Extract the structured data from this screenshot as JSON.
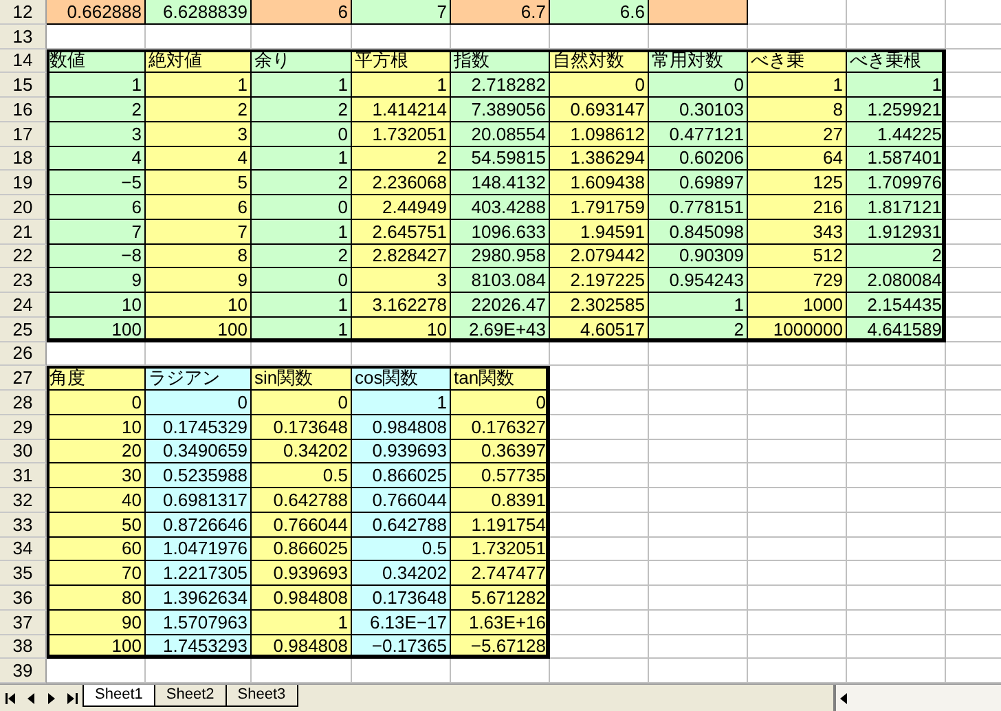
{
  "sheet": {
    "sections": [
      {
        "kind": "plain",
        "rows": [
          {
            "number": "12",
            "kind": "data",
            "cells": [
              {
                "text": "0.662888",
                "color": "#ffcc99"
              },
              {
                "text": "6.6288839",
                "color": "#ccffcc"
              },
              {
                "text": "6",
                "color": "#ffcc99"
              },
              {
                "text": "7",
                "color": "#ccffcc"
              },
              {
                "text": "6.7",
                "color": "#ffcc99"
              },
              {
                "text": "6.6",
                "color": "#ccffcc"
              },
              {
                "text": "",
                "color": "#ffcc99"
              }
            ]
          },
          {
            "number": "13",
            "cells": []
          }
        ]
      },
      {
        "kind": "table",
        "rows": [
          {
            "number": "14",
            "kind": "header",
            "cells": [
              {
                "text": "数値",
                "color": "#ccffcc"
              },
              {
                "text": "絶対値",
                "color": "#ffff99"
              },
              {
                "text": "余り",
                "color": "#ccffcc"
              },
              {
                "text": "平方根",
                "color": "#ffff99"
              },
              {
                "text": "指数",
                "color": "#ccffcc"
              },
              {
                "text": "自然対数",
                "color": "#ffff99"
              },
              {
                "text": "常用対数",
                "color": "#ccffcc"
              },
              {
                "text": "べき乗",
                "color": "#ffff99"
              },
              {
                "text": "べき乗根",
                "color": "#ccffcc"
              }
            ]
          },
          {
            "number": "15",
            "kind": "data",
            "cells": [
              {
                "text": "1",
                "color": "#ccffcc"
              },
              {
                "text": "1",
                "color": "#ffff99"
              },
              {
                "text": "1",
                "color": "#ccffcc"
              },
              {
                "text": "1",
                "color": "#ffff99"
              },
              {
                "text": "2.718282",
                "color": "#ccffcc"
              },
              {
                "text": "0",
                "color": "#ffff99"
              },
              {
                "text": "0",
                "color": "#ccffcc"
              },
              {
                "text": "1",
                "color": "#ffff99"
              },
              {
                "text": "1",
                "color": "#ccffcc"
              }
            ]
          },
          {
            "number": "16",
            "kind": "data",
            "cells": [
              {
                "text": "2",
                "color": "#ccffcc"
              },
              {
                "text": "2",
                "color": "#ffff99"
              },
              {
                "text": "2",
                "color": "#ccffcc"
              },
              {
                "text": "1.414214",
                "color": "#ffff99"
              },
              {
                "text": "7.389056",
                "color": "#ccffcc"
              },
              {
                "text": "0.693147",
                "color": "#ffff99"
              },
              {
                "text": "0.30103",
                "color": "#ccffcc"
              },
              {
                "text": "8",
                "color": "#ffff99"
              },
              {
                "text": "1.259921",
                "color": "#ccffcc"
              }
            ]
          },
          {
            "number": "17",
            "kind": "data",
            "cells": [
              {
                "text": "3",
                "color": "#ccffcc"
              },
              {
                "text": "3",
                "color": "#ffff99"
              },
              {
                "text": "0",
                "color": "#ccffcc"
              },
              {
                "text": "1.732051",
                "color": "#ffff99"
              },
              {
                "text": "20.08554",
                "color": "#ccffcc"
              },
              {
                "text": "1.098612",
                "color": "#ffff99"
              },
              {
                "text": "0.477121",
                "color": "#ccffcc"
              },
              {
                "text": "27",
                "color": "#ffff99"
              },
              {
                "text": "1.44225",
                "color": "#ccffcc"
              }
            ]
          },
          {
            "number": "18",
            "kind": "data",
            "cells": [
              {
                "text": "4",
                "color": "#ccffcc"
              },
              {
                "text": "4",
                "color": "#ffff99"
              },
              {
                "text": "1",
                "color": "#ccffcc"
              },
              {
                "text": "2",
                "color": "#ffff99"
              },
              {
                "text": "54.59815",
                "color": "#ccffcc"
              },
              {
                "text": "1.386294",
                "color": "#ffff99"
              },
              {
                "text": "0.60206",
                "color": "#ccffcc"
              },
              {
                "text": "64",
                "color": "#ffff99"
              },
              {
                "text": "1.587401",
                "color": "#ccffcc"
              }
            ]
          },
          {
            "number": "19",
            "kind": "data",
            "cells": [
              {
                "text": "−5",
                "color": "#ccffcc"
              },
              {
                "text": "5",
                "color": "#ffff99"
              },
              {
                "text": "2",
                "color": "#ccffcc"
              },
              {
                "text": "2.236068",
                "color": "#ffff99"
              },
              {
                "text": "148.4132",
                "color": "#ccffcc"
              },
              {
                "text": "1.609438",
                "color": "#ffff99"
              },
              {
                "text": "0.69897",
                "color": "#ccffcc"
              },
              {
                "text": "125",
                "color": "#ffff99"
              },
              {
                "text": "1.709976",
                "color": "#ccffcc"
              }
            ]
          },
          {
            "number": "20",
            "kind": "data",
            "cells": [
              {
                "text": "6",
                "color": "#ccffcc"
              },
              {
                "text": "6",
                "color": "#ffff99"
              },
              {
                "text": "0",
                "color": "#ccffcc"
              },
              {
                "text": "2.44949",
                "color": "#ffff99"
              },
              {
                "text": "403.4288",
                "color": "#ccffcc"
              },
              {
                "text": "1.791759",
                "color": "#ffff99"
              },
              {
                "text": "0.778151",
                "color": "#ccffcc"
              },
              {
                "text": "216",
                "color": "#ffff99"
              },
              {
                "text": "1.817121",
                "color": "#ccffcc"
              }
            ]
          },
          {
            "number": "21",
            "kind": "data",
            "cells": [
              {
                "text": "7",
                "color": "#ccffcc"
              },
              {
                "text": "7",
                "color": "#ffff99"
              },
              {
                "text": "1",
                "color": "#ccffcc"
              },
              {
                "text": "2.645751",
                "color": "#ffff99"
              },
              {
                "text": "1096.633",
                "color": "#ccffcc"
              },
              {
                "text": "1.94591",
                "color": "#ffff99"
              },
              {
                "text": "0.845098",
                "color": "#ccffcc"
              },
              {
                "text": "343",
                "color": "#ffff99"
              },
              {
                "text": "1.912931",
                "color": "#ccffcc"
              }
            ]
          },
          {
            "number": "22",
            "kind": "data",
            "cells": [
              {
                "text": "−8",
                "color": "#ccffcc"
              },
              {
                "text": "8",
                "color": "#ffff99"
              },
              {
                "text": "2",
                "color": "#ccffcc"
              },
              {
                "text": "2.828427",
                "color": "#ffff99"
              },
              {
                "text": "2980.958",
                "color": "#ccffcc"
              },
              {
                "text": "2.079442",
                "color": "#ffff99"
              },
              {
                "text": "0.90309",
                "color": "#ccffcc"
              },
              {
                "text": "512",
                "color": "#ffff99"
              },
              {
                "text": "2",
                "color": "#ccffcc"
              }
            ]
          },
          {
            "number": "23",
            "kind": "data",
            "cells": [
              {
                "text": "9",
                "color": "#ccffcc"
              },
              {
                "text": "9",
                "color": "#ffff99"
              },
              {
                "text": "0",
                "color": "#ccffcc"
              },
              {
                "text": "3",
                "color": "#ffff99"
              },
              {
                "text": "8103.084",
                "color": "#ccffcc"
              },
              {
                "text": "2.197225",
                "color": "#ffff99"
              },
              {
                "text": "0.954243",
                "color": "#ccffcc"
              },
              {
                "text": "729",
                "color": "#ffff99"
              },
              {
                "text": "2.080084",
                "color": "#ccffcc"
              }
            ]
          },
          {
            "number": "24",
            "kind": "data",
            "cells": [
              {
                "text": "10",
                "color": "#ccffcc"
              },
              {
                "text": "10",
                "color": "#ffff99"
              },
              {
                "text": "1",
                "color": "#ccffcc"
              },
              {
                "text": "3.162278",
                "color": "#ffff99"
              },
              {
                "text": "22026.47",
                "color": "#ccffcc"
              },
              {
                "text": "2.302585",
                "color": "#ffff99"
              },
              {
                "text": "1",
                "color": "#ccffcc"
              },
              {
                "text": "1000",
                "color": "#ffff99"
              },
              {
                "text": "2.154435",
                "color": "#ccffcc"
              }
            ]
          },
          {
            "number": "25",
            "kind": "data",
            "cells": [
              {
                "text": "100",
                "color": "#ccffcc"
              },
              {
                "text": "100",
                "color": "#ffff99"
              },
              {
                "text": "1",
                "color": "#ccffcc"
              },
              {
                "text": "10",
                "color": "#ffff99"
              },
              {
                "text": "2.69E+43",
                "color": "#ccffcc"
              },
              {
                "text": "4.60517",
                "color": "#ffff99"
              },
              {
                "text": "2",
                "color": "#ccffcc"
              },
              {
                "text": "1000000",
                "color": "#ffff99"
              },
              {
                "text": "4.641589",
                "color": "#ccffcc"
              }
            ]
          }
        ]
      },
      {
        "rows": [
          {
            "number": "26",
            "cells": []
          }
        ]
      },
      {
        "kind": "table",
        "rows": [
          {
            "number": "27",
            "kind": "header",
            "cells": [
              {
                "text": "角度",
                "color": "#ffff99"
              },
              {
                "text": "ラジアン",
                "color": "#ccffff"
              },
              {
                "text": "sin関数",
                "color": "#ffff99"
              },
              {
                "text": "cos関数",
                "color": "#ccffff"
              },
              {
                "text": "tan関数",
                "color": "#ffff99"
              }
            ]
          },
          {
            "number": "28",
            "kind": "data",
            "cells": [
              {
                "text": "0",
                "color": "#ffff99"
              },
              {
                "text": "0",
                "color": "#ccffff"
              },
              {
                "text": "0",
                "color": "#ffff99"
              },
              {
                "text": "1",
                "color": "#ccffff"
              },
              {
                "text": "0",
                "color": "#ffff99"
              }
            ]
          },
          {
            "number": "29",
            "kind": "data",
            "cells": [
              {
                "text": "10",
                "color": "#ffff99"
              },
              {
                "text": "0.1745329",
                "color": "#ccffff"
              },
              {
                "text": "0.173648",
                "color": "#ffff99"
              },
              {
                "text": "0.984808",
                "color": "#ccffff"
              },
              {
                "text": "0.176327",
                "color": "#ffff99"
              }
            ]
          },
          {
            "number": "30",
            "kind": "data",
            "cells": [
              {
                "text": "20",
                "color": "#ffff99"
              },
              {
                "text": "0.3490659",
                "color": "#ccffff"
              },
              {
                "text": "0.34202",
                "color": "#ffff99"
              },
              {
                "text": "0.939693",
                "color": "#ccffff"
              },
              {
                "text": "0.36397",
                "color": "#ffff99"
              }
            ]
          },
          {
            "number": "31",
            "kind": "data",
            "cells": [
              {
                "text": "30",
                "color": "#ffff99"
              },
              {
                "text": "0.5235988",
                "color": "#ccffff"
              },
              {
                "text": "0.5",
                "color": "#ffff99"
              },
              {
                "text": "0.866025",
                "color": "#ccffff"
              },
              {
                "text": "0.57735",
                "color": "#ffff99"
              }
            ]
          },
          {
            "number": "32",
            "kind": "data",
            "cells": [
              {
                "text": "40",
                "color": "#ffff99"
              },
              {
                "text": "0.6981317",
                "color": "#ccffff"
              },
              {
                "text": "0.642788",
                "color": "#ffff99"
              },
              {
                "text": "0.766044",
                "color": "#ccffff"
              },
              {
                "text": "0.8391",
                "color": "#ffff99"
              }
            ]
          },
          {
            "number": "33",
            "kind": "data",
            "cells": [
              {
                "text": "50",
                "color": "#ffff99"
              },
              {
                "text": "0.8726646",
                "color": "#ccffff"
              },
              {
                "text": "0.766044",
                "color": "#ffff99"
              },
              {
                "text": "0.642788",
                "color": "#ccffff"
              },
              {
                "text": "1.191754",
                "color": "#ffff99"
              }
            ]
          },
          {
            "number": "34",
            "kind": "data",
            "cells": [
              {
                "text": "60",
                "color": "#ffff99"
              },
              {
                "text": "1.0471976",
                "color": "#ccffff"
              },
              {
                "text": "0.866025",
                "color": "#ffff99"
              },
              {
                "text": "0.5",
                "color": "#ccffff"
              },
              {
                "text": "1.732051",
                "color": "#ffff99"
              }
            ]
          },
          {
            "number": "35",
            "kind": "data",
            "cells": [
              {
                "text": "70",
                "color": "#ffff99"
              },
              {
                "text": "1.2217305",
                "color": "#ccffff"
              },
              {
                "text": "0.939693",
                "color": "#ffff99"
              },
              {
                "text": "0.34202",
                "color": "#ccffff"
              },
              {
                "text": "2.747477",
                "color": "#ffff99"
              }
            ]
          },
          {
            "number": "36",
            "kind": "data",
            "cells": [
              {
                "text": "80",
                "color": "#ffff99"
              },
              {
                "text": "1.3962634",
                "color": "#ccffff"
              },
              {
                "text": "0.984808",
                "color": "#ffff99"
              },
              {
                "text": "0.173648",
                "color": "#ccffff"
              },
              {
                "text": "5.671282",
                "color": "#ffff99"
              }
            ]
          },
          {
            "number": "37",
            "kind": "data",
            "cells": [
              {
                "text": "90",
                "color": "#ffff99"
              },
              {
                "text": "1.5707963",
                "color": "#ccffff"
              },
              {
                "text": "1",
                "color": "#ffff99"
              },
              {
                "text": "6.13E−17",
                "color": "#ccffff"
              },
              {
                "text": "1.63E+16",
                "color": "#ffff99"
              }
            ]
          },
          {
            "number": "38",
            "kind": "data",
            "cells": [
              {
                "text": "100",
                "color": "#ffff99"
              },
              {
                "text": "1.7453293",
                "color": "#ccffff"
              },
              {
                "text": "0.984808",
                "color": "#ffff99"
              },
              {
                "text": "−0.17365",
                "color": "#ccffff"
              },
              {
                "text": "−5.67128",
                "color": "#ffff99"
              }
            ]
          }
        ]
      },
      {
        "rows": [
          {
            "number": "39",
            "cells": []
          }
        ]
      }
    ]
  },
  "tabs": [
    {
      "label": "Sheet1",
      "selected": true
    },
    {
      "label": "Sheet2",
      "selected": false
    },
    {
      "label": "Sheet3",
      "selected": false
    }
  ]
}
